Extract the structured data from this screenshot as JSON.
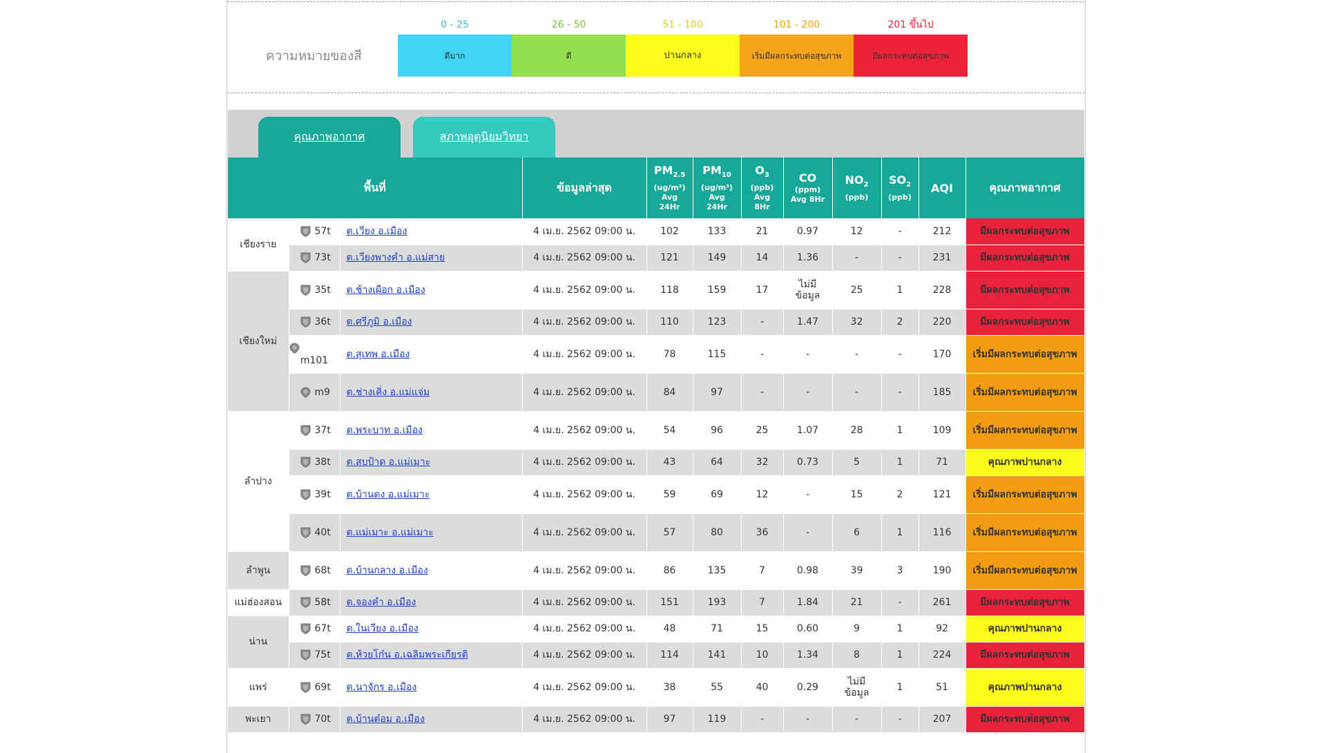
{
  "legend": {
    "title": "ความหมายของสี",
    "items": [
      {
        "range": "0 - 25",
        "label": "ดีมาก",
        "range_color": "#3fb6e8",
        "box_color": "#42d3f5"
      },
      {
        "range": "26 - 50",
        "label": "ดี",
        "range_color": "#7cc23d",
        "box_color": "#92e04e"
      },
      {
        "range": "51 - 100",
        "label": "ปานกลาง",
        "range_color": "#d9d21a",
        "box_color": "#fbfb1c"
      },
      {
        "range": "101 - 200",
        "label": "เริ่มมีผลกระทบต่อสุขภาพ",
        "range_color": "#f2a00c",
        "box_color": "#f4a31a"
      },
      {
        "range": "201 ขึ้นไป",
        "label": "มีผลกระทบต่อสุขภาพ",
        "range_color": "#e8223b",
        "box_color": "#ec2238"
      }
    ]
  },
  "tabs": [
    {
      "label": "คุณภาพอากาศ",
      "active": true
    },
    {
      "label": "สภาพอุตุนิยมวิทยา",
      "active": false
    }
  ],
  "table": {
    "headers": {
      "area": "พื้นที่",
      "latest": "ข้อมูลล่าสุด",
      "pm25": {
        "name": "PM",
        "sub": "2.5",
        "unit": "(ug/m³)",
        "avg": "Avg",
        "period": "24Hr"
      },
      "pm10": {
        "name": "PM",
        "sub": "10",
        "unit": "(ug/m³)",
        "avg": "Avg",
        "period": "24Hr"
      },
      "o3": {
        "name": "O",
        "sub": "3",
        "unit": "(ppb)",
        "avg": "Avg",
        "period": "8Hr"
      },
      "co": {
        "name": "CO",
        "unit": "(ppm)",
        "avg": "Avg 8Hr"
      },
      "no2": {
        "name": "NO",
        "sub": "2",
        "unit": "(ppb)"
      },
      "so2": {
        "name": "SO",
        "sub": "2",
        "unit": "(ppb)"
      },
      "aqi": "AQI",
      "quality": "คุณภาพอากาศ"
    },
    "provinces": [
      {
        "name": "เชียงราย",
        "rows": 2
      },
      {
        "name": "เชียงใหม่",
        "rows": 4
      },
      {
        "name": "ลำปาง",
        "rows": 4
      },
      {
        "name": "ลำพูน",
        "rows": 1
      },
      {
        "name": "แม่ฮ่องสอน",
        "rows": 1
      },
      {
        "name": "น่าน",
        "rows": 2
      },
      {
        "name": "แพร่",
        "rows": 1
      },
      {
        "name": "พะเยา",
        "rows": 1
      }
    ],
    "rows": [
      {
        "code": "57t",
        "station": "ต.เวียง อ.เมือง",
        "time": "4 เม.ย. 2562 09:00 น.",
        "pm25": "102",
        "pm10": "133",
        "o3": "21",
        "co": "0.97",
        "no2": "12",
        "so2": "-",
        "aqi": "212",
        "quality": "มีผลกระทบต่อสุขภาพ",
        "level": "red"
      },
      {
        "code": "73t",
        "station": "ต.เวียงพางคำ อ.แม่สาย",
        "time": "4 เม.ย. 2562 09:00 น.",
        "pm25": "121",
        "pm10": "149",
        "o3": "14",
        "co": "1.36",
        "no2": "-",
        "so2": "-",
        "aqi": "231",
        "quality": "มีผลกระทบต่อสุขภาพ",
        "level": "red"
      },
      {
        "code": "35t",
        "station": "ต.ช้างเผือก อ.เมือง",
        "time": "4 เม.ย. 2562 09:00 น.",
        "pm25": "118",
        "pm10": "159",
        "o3": "17",
        "co": "ไม่มีข้อมูล",
        "no2": "25",
        "so2": "1",
        "aqi": "228",
        "quality": "มีผลกระทบต่อสุขภาพ",
        "level": "red"
      },
      {
        "code": "36t",
        "station": "ต.ศรีภูมิ อ.เมือง",
        "time": "4 เม.ย. 2562 09:00 น.",
        "pm25": "110",
        "pm10": "123",
        "o3": "-",
        "co": "1.47",
        "no2": "32",
        "so2": "2",
        "aqi": "220",
        "quality": "มีผลกระทบต่อสุขภาพ",
        "level": "red"
      },
      {
        "code": "m101",
        "station": "ต.สุเทพ อ.เมือง",
        "time": "4 เม.ย. 2562 09:00 น.",
        "pm25": "78",
        "pm10": "115",
        "o3": "-",
        "co": "-",
        "no2": "-",
        "so2": "-",
        "aqi": "170",
        "quality": "เริ่มมีผลกระทบต่อสุขภาพ",
        "level": "orange"
      },
      {
        "code": "m9",
        "station": "ต.ช่างเคิ่ง อ.แม่แจ่ม",
        "time": "4 เม.ย. 2562 09:00 น.",
        "pm25": "84",
        "pm10": "97",
        "o3": "-",
        "co": "-",
        "no2": "-",
        "so2": "-",
        "aqi": "185",
        "quality": "เริ่มมีผลกระทบต่อสุขภาพ",
        "level": "orange"
      },
      {
        "code": "37t",
        "station": "ต.พระบาท อ.เมือง",
        "time": "4 เม.ย. 2562 09:00 น.",
        "pm25": "54",
        "pm10": "96",
        "o3": "25",
        "co": "1.07",
        "no2": "28",
        "so2": "1",
        "aqi": "109",
        "quality": "เริ่มมีผลกระทบต่อสุขภาพ",
        "level": "orange"
      },
      {
        "code": "38t",
        "station": "ต.สบป้าด อ.แม่เมาะ",
        "time": "4 เม.ย. 2562 09:00 น.",
        "pm25": "43",
        "pm10": "64",
        "o3": "32",
        "co": "0.73",
        "no2": "5",
        "so2": "1",
        "aqi": "71",
        "quality": "คุณภาพปานกลาง",
        "level": "yellow"
      },
      {
        "code": "39t",
        "station": "ต.บ้านดง อ.แม่เมาะ",
        "time": "4 เม.ย. 2562 09:00 น.",
        "pm25": "59",
        "pm10": "69",
        "o3": "12",
        "co": "-",
        "no2": "15",
        "so2": "2",
        "aqi": "121",
        "quality": "เริ่มมีผลกระทบต่อสุขภาพ",
        "level": "orange"
      },
      {
        "code": "40t",
        "station": "ต.แม่เมาะ อ.แม่เมาะ",
        "time": "4 เม.ย. 2562 09:00 น.",
        "pm25": "57",
        "pm10": "80",
        "o3": "36",
        "co": "-",
        "no2": "6",
        "so2": "1",
        "aqi": "116",
        "quality": "เริ่มมีผลกระทบต่อสุขภาพ",
        "level": "orange"
      },
      {
        "code": "68t",
        "station": "ต.บ้านกลาง อ.เมือง",
        "time": "4 เม.ย. 2562 09:00 น.",
        "pm25": "86",
        "pm10": "135",
        "o3": "7",
        "co": "0.98",
        "no2": "39",
        "so2": "3",
        "aqi": "190",
        "quality": "เริ่มมีผลกระทบต่อสุขภาพ",
        "level": "orange"
      },
      {
        "code": "58t",
        "station": "ต.จองคำ อ.เมือง",
        "time": "4 เม.ย. 2562 09:00 น.",
        "pm25": "151",
        "pm10": "193",
        "o3": "7",
        "co": "1.84",
        "no2": "21",
        "so2": "-",
        "aqi": "261",
        "quality": "มีผลกระทบต่อสุขภาพ",
        "level": "red"
      },
      {
        "code": "67t",
        "station": "ต.ในเวียง อ.เมือง",
        "time": "4 เม.ย. 2562 09:00 น.",
        "pm25": "48",
        "pm10": "71",
        "o3": "15",
        "co": "0.60",
        "no2": "9",
        "so2": "1",
        "aqi": "92",
        "quality": "คุณภาพปานกลาง",
        "level": "yellow"
      },
      {
        "code": "75t",
        "station": "ต.ห้วยโก๋น อ.เฉลิมพระเกียรติ",
        "time": "4 เม.ย. 2562 09:00 น.",
        "pm25": "114",
        "pm10": "141",
        "o3": "10",
        "co": "1.34",
        "no2": "8",
        "so2": "1",
        "aqi": "224",
        "quality": "มีผลกระทบต่อสุขภาพ",
        "level": "red"
      },
      {
        "code": "69t",
        "station": "ต.นาจักร อ.เมือง",
        "time": "4 เม.ย. 2562 09:00 น.",
        "pm25": "38",
        "pm10": "55",
        "o3": "40",
        "co": "0.29",
        "no2": "ไม่มีข้อมูล",
        "so2": "1",
        "aqi": "51",
        "quality": "คุณภาพปานกลาง",
        "level": "yellow"
      },
      {
        "code": "70t",
        "station": "ต.บ้านต๋อม อ.เมือง",
        "time": "4 เม.ย. 2562 09:00 น.",
        "pm25": "97",
        "pm10": "119",
        "o3": "-",
        "co": "-",
        "no2": "-",
        "so2": "-",
        "aqi": "207",
        "quality": "มีผลกระทบต่อสุขภาพ",
        "level": "red"
      }
    ]
  }
}
